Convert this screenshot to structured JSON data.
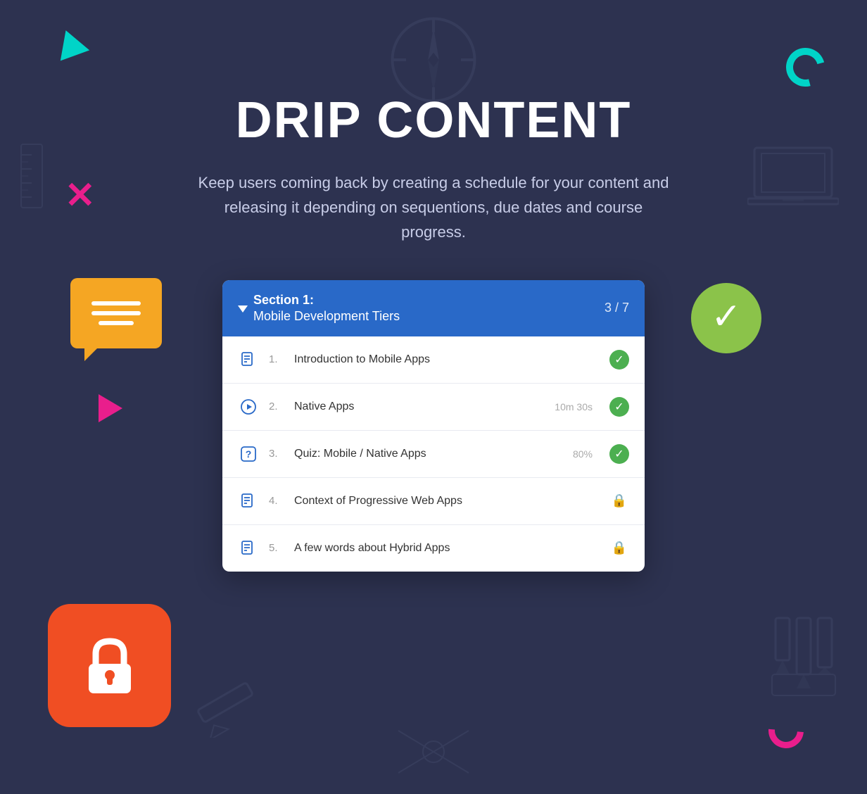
{
  "page": {
    "title": "DRIP CONTENT",
    "subtitle": "Keep users coming back by creating a schedule for your content and releasing it depending on sequentions, due dates and course progress.",
    "background_color": "#2d3250"
  },
  "section": {
    "label": "Section 1:",
    "name": "Mobile Development Tiers",
    "progress": "3 / 7"
  },
  "course_items": [
    {
      "number": "1.",
      "title": "Introduction to Mobile Apps",
      "type": "doc",
      "status": "complete",
      "meta": ""
    },
    {
      "number": "2.",
      "title": "Native Apps",
      "type": "video",
      "status": "complete",
      "meta": "10m 30s"
    },
    {
      "number": "3.",
      "title": "Quiz: Mobile / Native Apps",
      "type": "quiz",
      "status": "complete",
      "meta": "80%"
    },
    {
      "number": "4.",
      "title": "Context of Progressive Web Apps",
      "type": "doc",
      "status": "locked",
      "meta": ""
    },
    {
      "number": "5.",
      "title": "A few words about Hybrid Apps",
      "type": "doc",
      "status": "locked",
      "meta": ""
    }
  ],
  "colors": {
    "section_header": "#2969c8",
    "complete": "#4caf50",
    "locked": "#f04e23",
    "teal": "#00d4c8",
    "pink": "#e91e8c",
    "orange": "#f5a623",
    "green_check": "#8bc34a"
  }
}
